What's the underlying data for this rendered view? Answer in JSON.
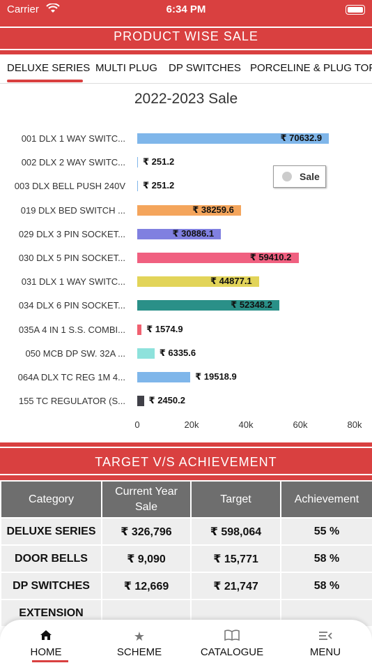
{
  "status_bar": {
    "carrier": "Carrier",
    "time": "6:34 PM"
  },
  "header": {
    "title": "PRODUCT WISE SALE"
  },
  "tabs": [
    {
      "label": "DELUXE SERIES"
    },
    {
      "label": "MULTI PLUG"
    },
    {
      "label": "DP SWITCHES"
    },
    {
      "label": "PORCELINE & PLUG TOPS"
    }
  ],
  "chart_data": {
    "type": "bar",
    "orientation": "horizontal",
    "title": "2022-2023 Sale",
    "categories": [
      "001 DLX 1 WAY SWITC...",
      "002 DLX 2 WAY SWITC...",
      "003 DLX BELL PUSH 240V",
      "019 DLX BED SWITCH ...",
      "029 DLX 3 PIN SOCKET...",
      "030 DLX 5 PIN SOCKET...",
      "031 DLX 1 WAY SWITC...",
      "034 DLX 6 PIN SOCKET...",
      "035A 4 IN 1 S.S. COMBI...",
      "050 MCB DP SW. 32A ...",
      "064A DLX TC REG 1M 4...",
      "155 TC REGULATOR (S..."
    ],
    "values": [
      70632.9,
      251.2,
      251.2,
      38259.6,
      30886.1,
      59410.2,
      44877.1,
      52348.2,
      1574.9,
      6335.6,
      19518.9,
      2450.2
    ],
    "value_labels": [
      "₹ 70632.9",
      "₹ 251.2",
      "₹ 251.2",
      "₹ 38259.6",
      "₹ 30886.1",
      "₹ 59410.2",
      "₹ 44877.1",
      "₹ 52348.2",
      "₹ 1574.9",
      "₹ 6335.6",
      "₹ 19518.9",
      "₹ 2450.2"
    ],
    "colors": [
      "#7fb6ea",
      "#7fb6ea",
      "#7fb6ea",
      "#f4a55c",
      "#8080e0",
      "#f06080",
      "#e2d459",
      "#2a9088",
      "#f06070",
      "#8ee2dc",
      "#7fb6ea",
      "#404048"
    ],
    "x_ticks": [
      "0",
      "20k",
      "40k",
      "60k",
      "80k"
    ],
    "xlim": [
      0,
      80000
    ],
    "legend": {
      "label": "Sale",
      "position": "top-right"
    },
    "grid": false
  },
  "target_section": {
    "title": "TARGET V/S ACHIEVEMENT"
  },
  "table": {
    "headers": [
      "Category",
      "Current Year Sale",
      "Target",
      "Achievement"
    ],
    "rows": [
      [
        "DELUXE SERIES",
        "₹ 326,796",
        "₹ 598,064",
        "55 %"
      ],
      [
        "DOOR BELLS",
        "₹ 9,090",
        "₹ 15,771",
        "58 %"
      ],
      [
        "DP SWITCHES",
        "₹ 12,669",
        "₹ 21,747",
        "58 %"
      ],
      [
        "EXTENSION",
        "",
        "",
        ""
      ]
    ]
  },
  "bottom_nav": [
    {
      "label": "HOME",
      "icon": "home-icon"
    },
    {
      "label": "SCHEME",
      "icon": "star-icon"
    },
    {
      "label": "CATALOGUE",
      "icon": "book-icon"
    },
    {
      "label": "MENU",
      "icon": "menu-icon"
    }
  ],
  "colors": {
    "accent": "#d94040",
    "table_header": "#6e6e6e",
    "table_cell": "#eeeeee"
  }
}
